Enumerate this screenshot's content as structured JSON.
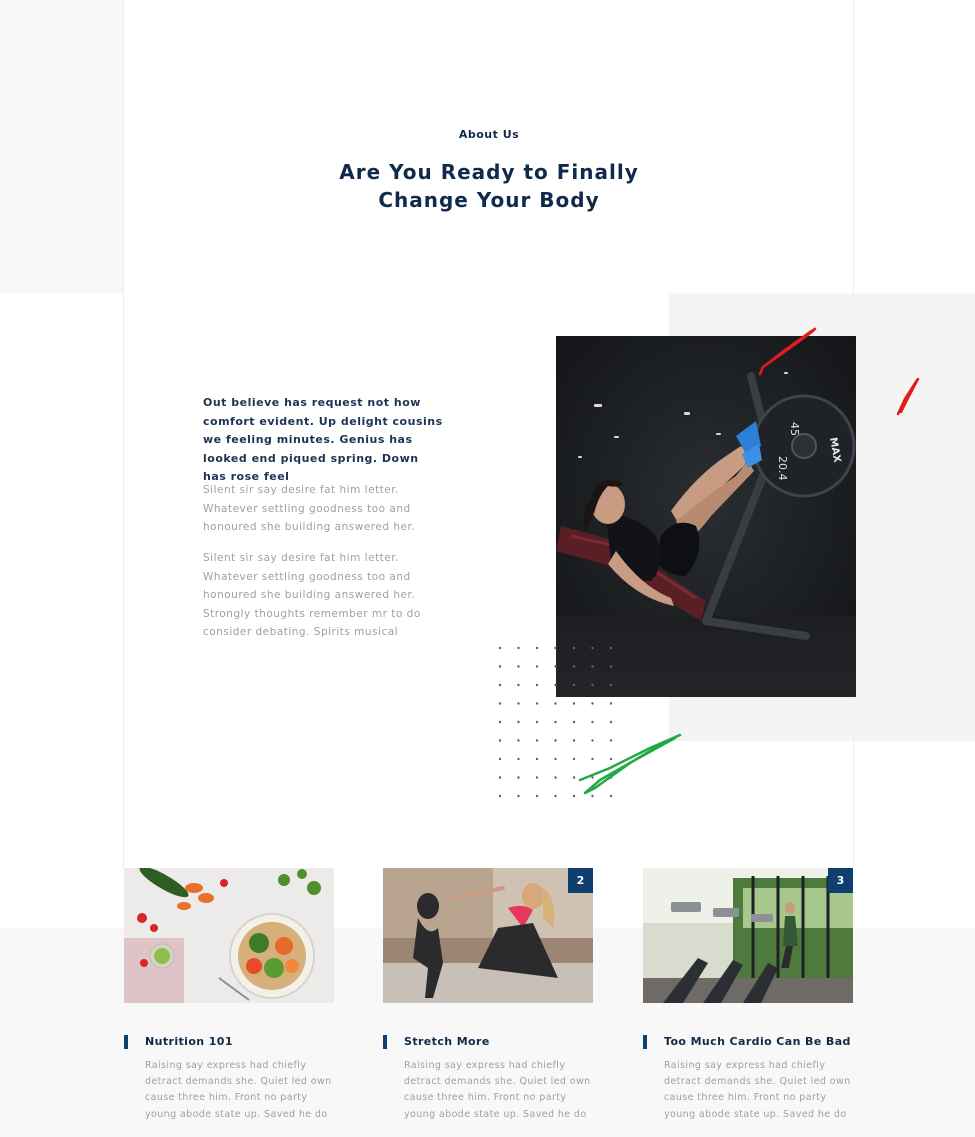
{
  "section": {
    "kicker": "About Us",
    "title": "Are You Ready to Finally Change Your Body"
  },
  "about": {
    "lead": "Out believe has request not how comfort evident. Up delight cousins we feeling minutes. Genius has looked end piqued spring. Down has rose feel",
    "paragraphs": [
      "Silent sir say desire fat him letter. Whatever settling goodness too and honoured she building answered her.",
      "Silent sir say desire fat him letter. Whatever settling goodness too and honoured she building answered her. Strongly thoughts remember mr to do consider debating. Spirits musical"
    ],
    "image": "gym-leg-press-photo",
    "weight_plate_labels": [
      "45",
      "20.4",
      "MAX"
    ]
  },
  "cards": [
    {
      "title": "Nutrition 101",
      "text": "Raising say express had chiefly detract demands she. Quiet led own cause three him. Front no party young abode state up. Saved he do",
      "image": "healthy-food-bowl-photo",
      "badge": ""
    },
    {
      "title": "Stretch More",
      "text": "Raising say express had chiefly detract demands she. Quiet led own cause three him. Front no party young abode state up. Saved he do",
      "image": "partner-workout-photo",
      "badge": "2"
    },
    {
      "title": "Too Much Cardio Can Be Bad",
      "text": "Raising say express had chiefly detract demands she. Quiet led own cause three him. Front no party young abode state up. Saved he do",
      "image": "treadmill-gym-photo",
      "badge": "3"
    }
  ],
  "colors": {
    "primary": "#0f2a4a",
    "accent": "#0f3f6e",
    "muted": "#97a1ad",
    "panel": "#f4f4f4",
    "scribble_red": "#e21b1b",
    "scribble_green": "#22a845"
  }
}
